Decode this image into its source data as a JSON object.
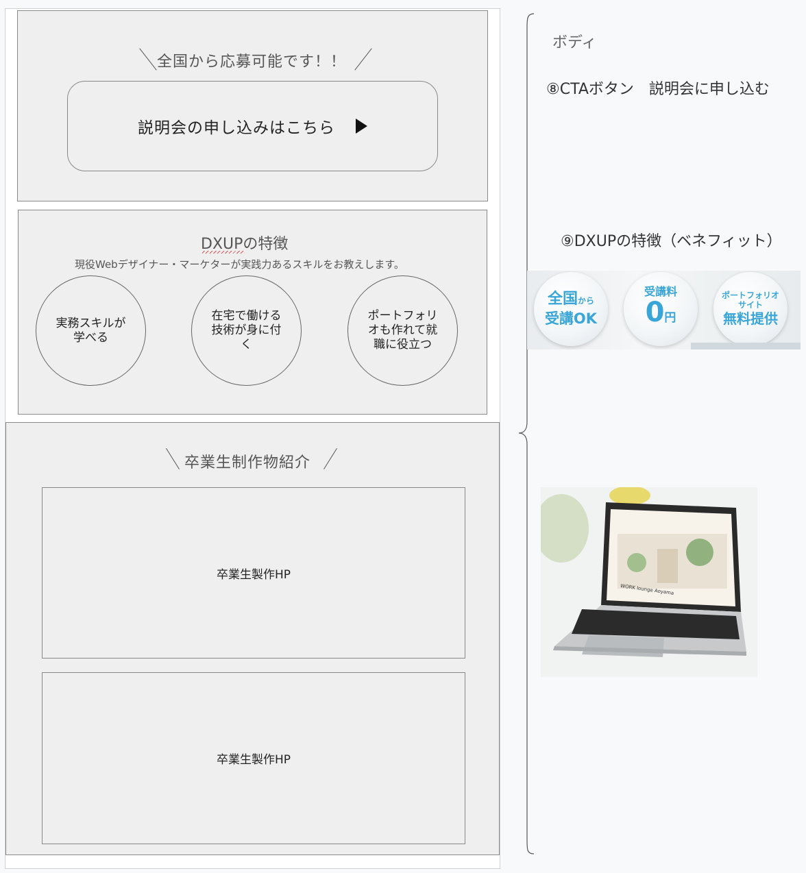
{
  "cta_section": {
    "heading": "全国から応募可能です！！",
    "button_label": "説明会の申し込みはこちら"
  },
  "features_section": {
    "title": "DXUPの特徴",
    "subtitle": "現役Webデザイナー・マーケターが実践力あるスキルをお教えします。",
    "circles": [
      {
        "text": "実務スキルが学べる"
      },
      {
        "text": "在宅で働ける技術が身に付く"
      },
      {
        "text": "ポートフォリオも作れて就職に役立つ"
      }
    ]
  },
  "works_section": {
    "heading": "卒業生制作物紹介",
    "items": [
      {
        "label": "卒業生製作HP"
      },
      {
        "label": "卒業生製作HP"
      }
    ]
  },
  "annotations": {
    "body_label": "ボディ",
    "cta_note": "⑧CTAボタン　説明会に申し込む",
    "features_note": "⑨DXUPの特徴（ベネフィット）"
  },
  "banner": {
    "badges": [
      {
        "line1_main": "全国",
        "line1_small": "から",
        "line2": "受講OK"
      },
      {
        "line1": "受講料",
        "big": "0",
        "unit": "円"
      },
      {
        "line1": "ポートフォリオ",
        "line1b": "サイト",
        "line2": "無料提供"
      }
    ],
    "accent_color": "#3aa6d8"
  },
  "laptop_screen": {
    "site_text": "WORK lounge Aoyama"
  }
}
